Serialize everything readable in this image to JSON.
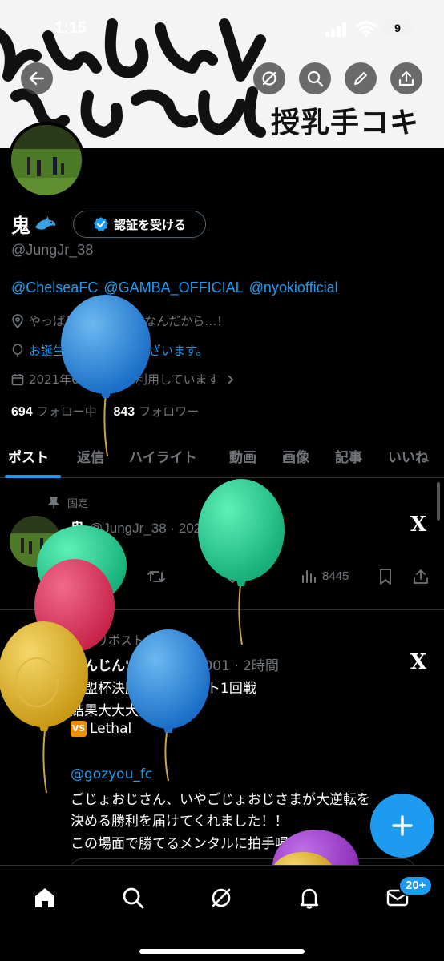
{
  "status_bar": {
    "time": "1:15",
    "battery": "9"
  },
  "banner": {
    "caption": "授乳手コキ"
  },
  "profile": {
    "name": "鬼",
    "verify_label": "認証を受ける",
    "handle": "@JungJr_38",
    "bio_links": [
      "@ChelseaFC",
      "@GAMBA_OFFICIAL",
      "@nyokiofficial"
    ],
    "location": "やっぱりだいが、1番なんだから…！",
    "birthday": "お誕生日おめでとうございます。",
    "joined": "2021年6月からXを利用しています",
    "following_count": "694",
    "following_label": "フォロー中",
    "followers_count": "843",
    "followers_label": "フォロワー"
  },
  "tabs": [
    "ポスト",
    "返信",
    "ハイライト",
    "動画",
    "画像",
    "記事",
    "いいね"
  ],
  "pinned_tweet": {
    "pinned_label": "固定",
    "name": "鬼",
    "handle_date": "@JungJr_38 · 2024/06/14",
    "likes": "5",
    "views": "8445"
  },
  "repost_tweet": {
    "repost_label": "あなたがリポストしました",
    "name": "じんじん's",
    "handle_time": "@jinjins1001 · 2時間",
    "line1": "同盟杯決勝トーナメント1回戦",
    "line2_prefix": "結果大大大",
    "line2_link": "速報",
    "line3_badge": "VS",
    "line3_text": "Lethal",
    "mention": "@gozyou_fc",
    "body1": "ごじょおじさん、いやごじょおじさまが大逆転を",
    "body2": "決める勝利を届けてくれました！！",
    "body3": "この場面で勝てるメンタルに拍手喝采。"
  },
  "nav": {
    "badge": "20+"
  },
  "colors": {
    "accent": "#1d9bf0",
    "background": "#000000",
    "muted": "#71767b"
  },
  "icons": [
    "back-icon",
    "grok-icon",
    "search-icon",
    "edit-icon",
    "share-icon",
    "verified-icon",
    "location-icon",
    "balloon-icon",
    "calendar-icon",
    "pin-icon",
    "retweet-icon",
    "heart-icon",
    "views-icon",
    "bookmark-icon",
    "plus-icon",
    "home-icon",
    "notification-icon",
    "mail-icon",
    "x-logo-icon"
  ]
}
